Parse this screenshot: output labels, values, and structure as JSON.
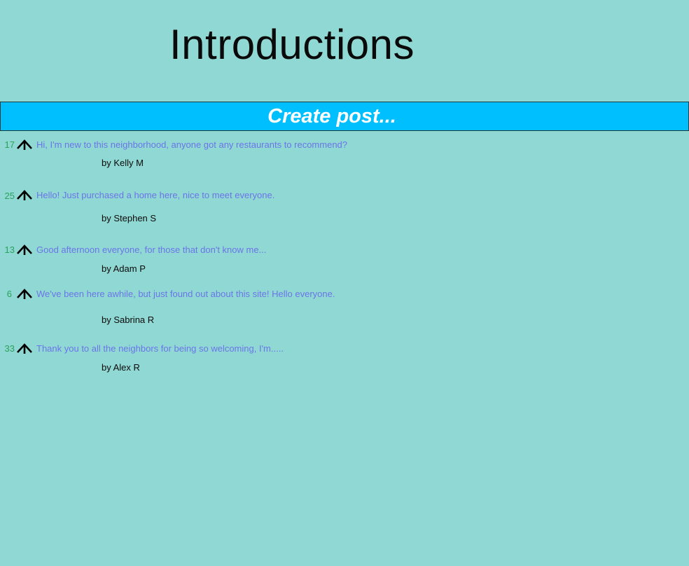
{
  "page": {
    "title": "Introductions"
  },
  "create_post": {
    "label": "Create post..."
  },
  "posts": [
    {
      "votes": "17",
      "title": "Hi,  I'm new to this neighborhood, anyone got any restaurants to recommend?",
      "author": "by Kelly M"
    },
    {
      "votes": "25",
      "title": "Hello!  Just purchased a home here, nice to meet everyone.",
      "author": "by Stephen S"
    },
    {
      "votes": "13",
      "title": "Good afternoon everyone, for those that don't know me...",
      "author": "by Adam P"
    },
    {
      "votes": "6",
      "title": "We've been here awhile, but just found out about this site!  Hello everyone.",
      "author": "by Sabrina R"
    },
    {
      "votes": "33",
      "title": "Thank you to all the neighbors for being so welcoming, I'm.....",
      "author": "by Alex R"
    }
  ],
  "icons": {
    "upvote": "arrow-up-icon"
  },
  "colors": {
    "background": "#90d8d3",
    "create_post_bar": "#00bfff",
    "vote_count": "#2aa25a",
    "post_title": "#6a75e8"
  }
}
